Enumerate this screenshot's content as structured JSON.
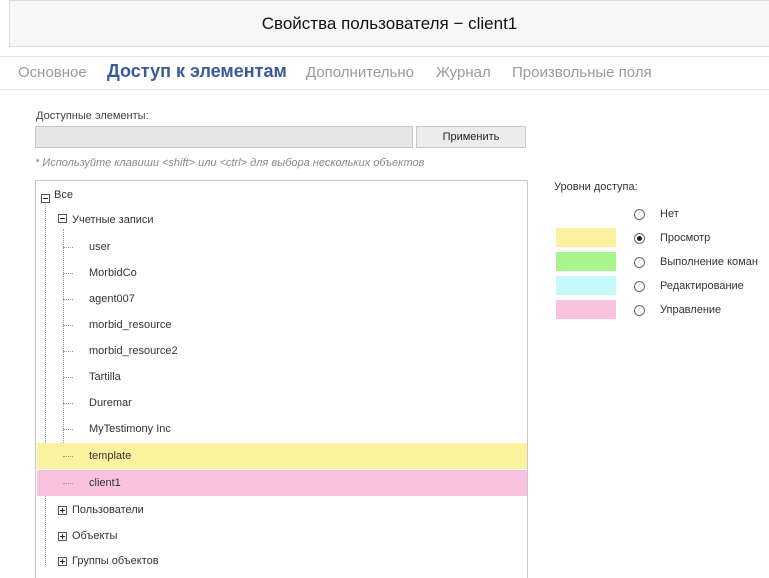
{
  "window": {
    "title": "Свойства пользователя − client1"
  },
  "tabs": [
    {
      "label": "Основное",
      "active": false
    },
    {
      "label": "Доступ к элементам",
      "active": true
    },
    {
      "label": "Дополнительно",
      "active": false
    },
    {
      "label": "Журнал",
      "active": false
    },
    {
      "label": "Произвольные поля",
      "active": false
    }
  ],
  "elements": {
    "label": "Доступные элементы:",
    "input_value": "",
    "apply_label": "Применить",
    "hint": "* Используйте клавиши <shift> или <ctrl> для выбора нескольких объектов"
  },
  "tree": {
    "root": "Все",
    "accounts_group": "Учетные записи",
    "accounts": [
      {
        "label": "user",
        "access": "none"
      },
      {
        "label": "MorbidCo",
        "access": "none"
      },
      {
        "label": "agent007",
        "access": "none"
      },
      {
        "label": "morbid_resource",
        "access": "none"
      },
      {
        "label": "morbid_resource2",
        "access": "none"
      },
      {
        "label": "Tartilla",
        "access": "none"
      },
      {
        "label": "Duremar",
        "access": "none"
      },
      {
        "label": "MyTestimony Inc",
        "access": "none"
      },
      {
        "label": "template",
        "access": "view"
      },
      {
        "label": "client1",
        "access": "manage"
      }
    ],
    "collapsed_groups": [
      "Пользователи",
      "Объекты",
      "Группы объектов"
    ]
  },
  "access_levels": {
    "title": "Уровни доступа:",
    "selected": "view",
    "levels": [
      {
        "key": "none",
        "label": "Нет",
        "color": ""
      },
      {
        "key": "view",
        "label": "Просмотр",
        "color": "#fbf2a0"
      },
      {
        "key": "exec",
        "label": "Выполнение коман",
        "color": "#a8f48e"
      },
      {
        "key": "edit",
        "label": "Редактирование",
        "color": "#c6f9fb"
      },
      {
        "key": "manage",
        "label": "Управление",
        "color": "#fbc2e0"
      }
    ]
  }
}
